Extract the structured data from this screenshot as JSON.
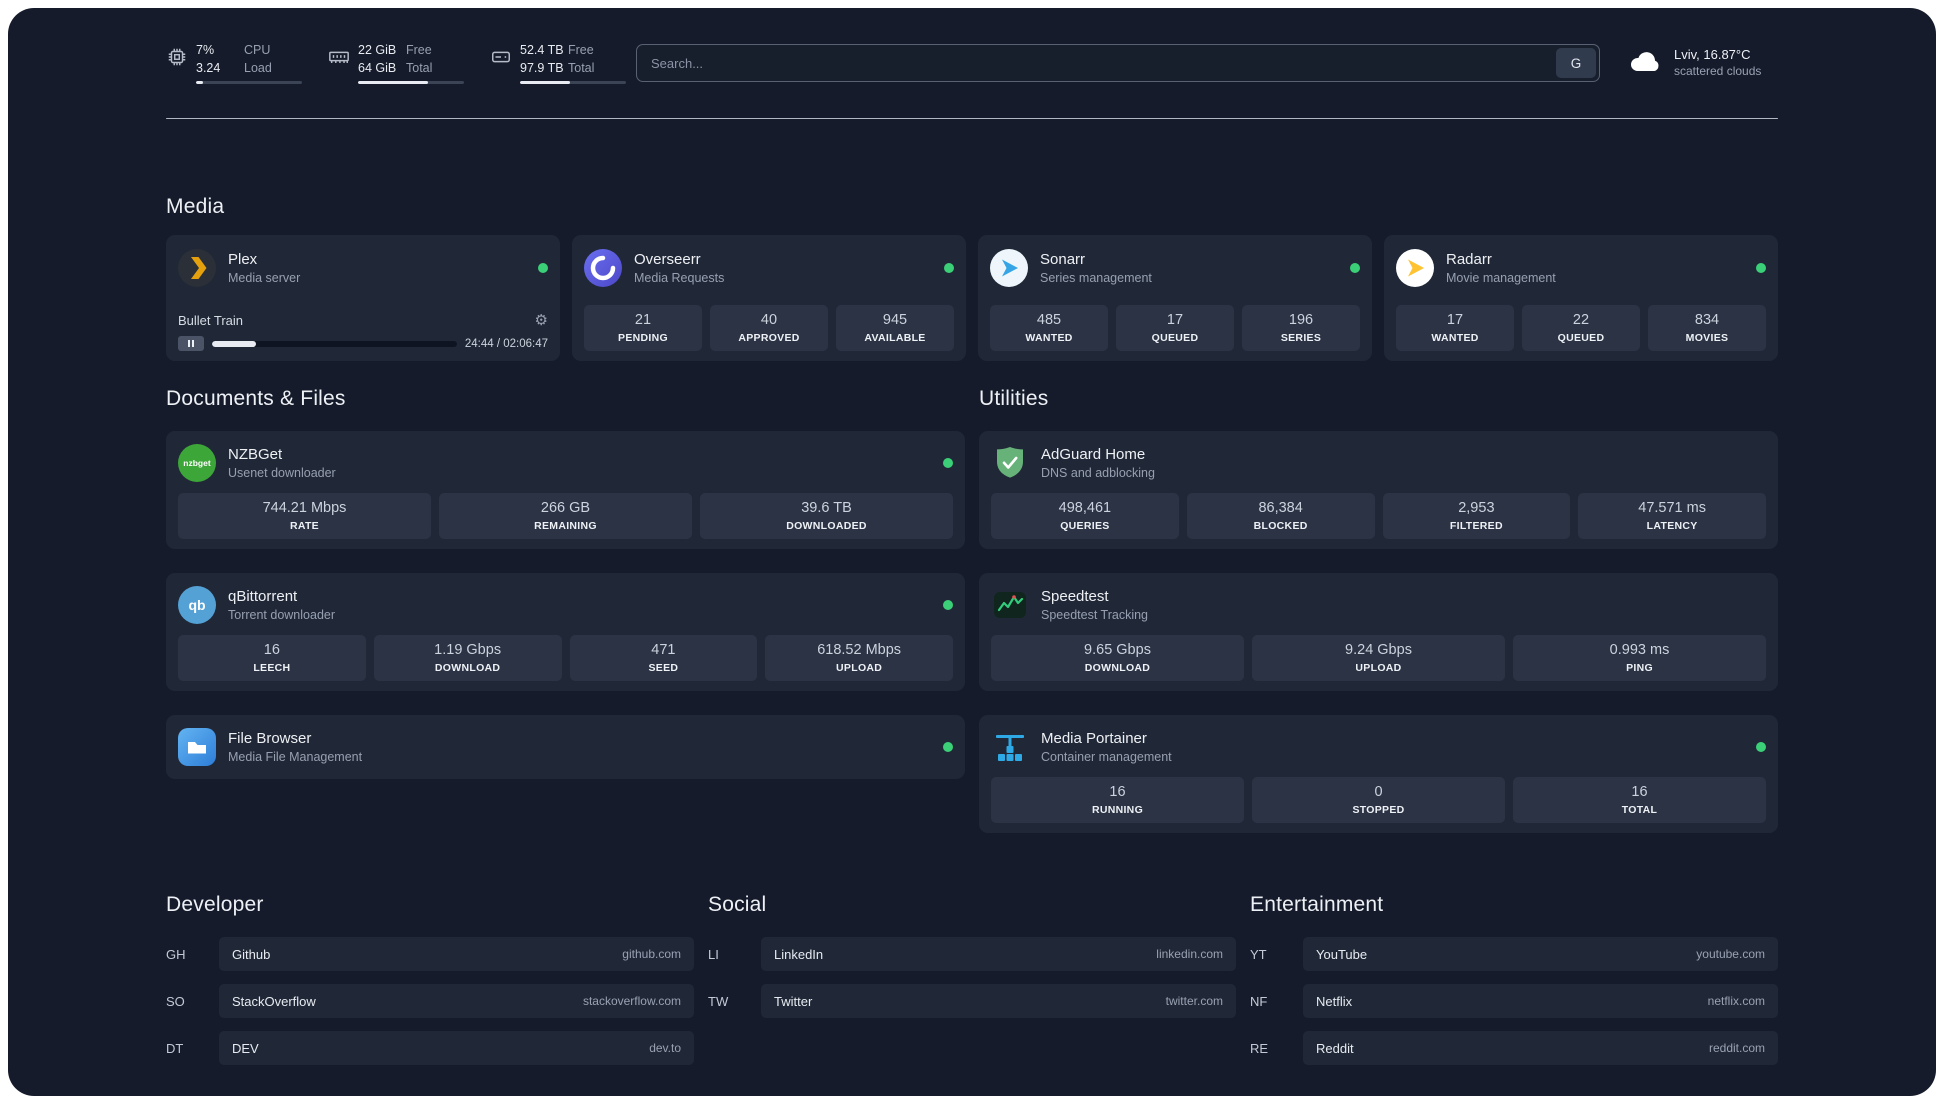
{
  "colors": {
    "background": "#151b2a",
    "card": "#202837",
    "stat_box": "#2b3344",
    "status_green": "#3bd078",
    "plex_gold": "#e5a00d",
    "overseerr_purple": "#5a5fd6",
    "sonarr_blue": "#35a5e5",
    "radarr_gold": "#ffc230",
    "nzbget_green": "#3da639",
    "qbittorrent_blue": "#54a1d6",
    "adguard_green": "#67b279",
    "portainer_blue": "#2ea9e5"
  },
  "header": {
    "cpu": {
      "value1": "7%",
      "value2": "3.24",
      "label1": "CPU",
      "label2": "Load",
      "bar_percent": 7
    },
    "ram": {
      "value1": "22 GiB",
      "value2": "64 GiB",
      "label1": "Free",
      "label2": "Total",
      "bar_percent": 66
    },
    "disk": {
      "value1": "52.4 TB",
      "value2": "97.9 TB",
      "label1": "Free",
      "label2": "Total",
      "bar_percent": 47
    },
    "search": {
      "placeholder": "Search...",
      "provider": "G"
    },
    "weather": {
      "location": "Lviv, 16.87°C",
      "condition": "scattered clouds"
    }
  },
  "media": {
    "title": "Media",
    "plex": {
      "name": "Plex",
      "desc": "Media server",
      "now_playing": {
        "title": "Bullet Train",
        "time": "24:44 / 02:06:47",
        "progress": 18
      }
    },
    "overseerr": {
      "name": "Overseerr",
      "desc": "Media Requests",
      "stats": [
        {
          "value": "21",
          "label": "PENDING"
        },
        {
          "value": "40",
          "label": "APPROVED"
        },
        {
          "value": "945",
          "label": "AVAILABLE"
        }
      ]
    },
    "sonarr": {
      "name": "Sonarr",
      "desc": "Series management",
      "stats": [
        {
          "value": "485",
          "label": "WANTED"
        },
        {
          "value": "17",
          "label": "QUEUED"
        },
        {
          "value": "196",
          "label": "SERIES"
        }
      ]
    },
    "radarr": {
      "name": "Radarr",
      "desc": "Movie management",
      "stats": [
        {
          "value": "17",
          "label": "WANTED"
        },
        {
          "value": "22",
          "label": "QUEUED"
        },
        {
          "value": "834",
          "label": "MOVIES"
        }
      ]
    }
  },
  "documents": {
    "title": "Documents & Files",
    "nzbget": {
      "name": "NZBGet",
      "desc": "Usenet downloader",
      "icon_text": "nzbget",
      "stats": [
        {
          "value": "744.21 Mbps",
          "label": "RATE"
        },
        {
          "value": "266 GB",
          "label": "REMAINING"
        },
        {
          "value": "39.6 TB",
          "label": "DOWNLOADED"
        }
      ]
    },
    "qbittorrent": {
      "name": "qBittorrent",
      "desc": "Torrent downloader",
      "icon_text": "qb",
      "stats": [
        {
          "value": "16",
          "label": "LEECH"
        },
        {
          "value": "1.19 Gbps",
          "label": "DOWNLOAD"
        },
        {
          "value": "471",
          "label": "SEED"
        },
        {
          "value": "618.52 Mbps",
          "label": "UPLOAD"
        }
      ]
    },
    "filebrowser": {
      "name": "File Browser",
      "desc": "Media File Management"
    }
  },
  "utilities": {
    "title": "Utilities",
    "adguard": {
      "name": "AdGuard Home",
      "desc": "DNS and adblocking",
      "stats": [
        {
          "value": "498,461",
          "label": "QUERIES"
        },
        {
          "value": "86,384",
          "label": "BLOCKED"
        },
        {
          "value": "2,953",
          "label": "FILTERED"
        },
        {
          "value": "47.571 ms",
          "label": "LATENCY"
        }
      ]
    },
    "speedtest": {
      "name": "Speedtest",
      "desc": "Speedtest Tracking",
      "stats": [
        {
          "value": "9.65 Gbps",
          "label": "DOWNLOAD"
        },
        {
          "value": "9.24 Gbps",
          "label": "UPLOAD"
        },
        {
          "value": "0.993 ms",
          "label": "PING"
        }
      ]
    },
    "portainer": {
      "name": "Media Portainer",
      "desc": "Container management",
      "stats": [
        {
          "value": "16",
          "label": "RUNNING"
        },
        {
          "value": "0",
          "label": "STOPPED"
        },
        {
          "value": "16",
          "label": "TOTAL"
        }
      ]
    }
  },
  "bookmarks": {
    "developer": {
      "title": "Developer",
      "items": [
        {
          "abbr": "GH",
          "name": "Github",
          "url": "github.com"
        },
        {
          "abbr": "SO",
          "name": "StackOverflow",
          "url": "stackoverflow.com"
        },
        {
          "abbr": "DT",
          "name": "DEV",
          "url": "dev.to"
        }
      ]
    },
    "social": {
      "title": "Social",
      "items": [
        {
          "abbr": "LI",
          "name": "LinkedIn",
          "url": "linkedin.com"
        },
        {
          "abbr": "TW",
          "name": "Twitter",
          "url": "twitter.com"
        }
      ]
    },
    "entertainment": {
      "title": "Entertainment",
      "items": [
        {
          "abbr": "YT",
          "name": "YouTube",
          "url": "youtube.com"
        },
        {
          "abbr": "NF",
          "name": "Netflix",
          "url": "netflix.com"
        },
        {
          "abbr": "RE",
          "name": "Reddit",
          "url": "reddit.com"
        }
      ]
    }
  }
}
